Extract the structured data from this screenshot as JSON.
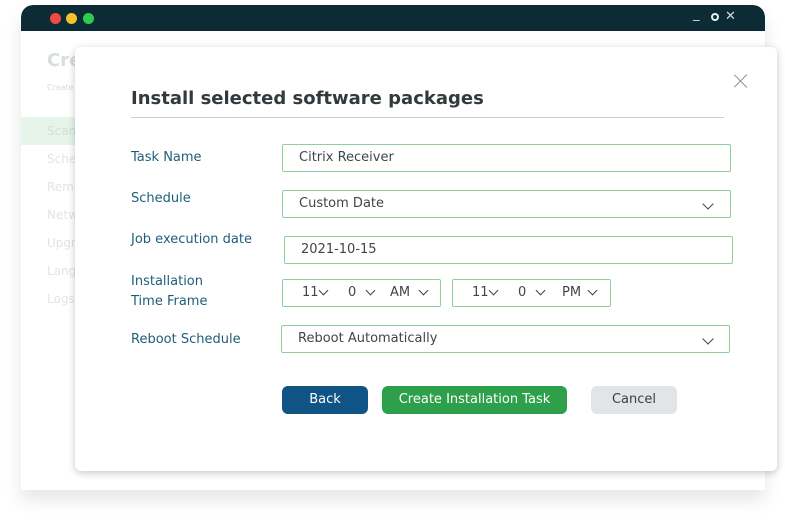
{
  "background": {
    "title": "Cre",
    "subtitle": "Create",
    "nav": [
      {
        "label": "Scan",
        "active": true
      },
      {
        "label": "Sche",
        "active": false
      },
      {
        "label": "Rem",
        "active": false
      },
      {
        "label": "Netw",
        "active": false
      },
      {
        "label": "Upgr",
        "active": false
      },
      {
        "label": "Lang",
        "active": false
      },
      {
        "label": "Logs",
        "active": false
      }
    ],
    "window_controls": {
      "minimize": "_",
      "close": "✕"
    }
  },
  "dialog": {
    "title": "Install selected software packages",
    "fields": {
      "task_name": {
        "label": "Task Name",
        "value": "Citrix Receiver"
      },
      "schedule": {
        "label": "Schedule",
        "value": "Custom Date"
      },
      "job_date": {
        "label": "Job execution date",
        "value": "2021-10-15"
      },
      "time_frame": {
        "label_line1": "Installation",
        "label_line2": "Time Frame",
        "start": {
          "hour": "11",
          "minute": "0",
          "meridiem": "AM"
        },
        "end": {
          "hour": "11",
          "minute": "0",
          "meridiem": "PM"
        }
      },
      "reboot": {
        "label": "Reboot Schedule",
        "value": "Reboot Automatically"
      }
    },
    "buttons": {
      "back": "Back",
      "create": "Create Installation Task",
      "cancel": "Cancel"
    }
  },
  "colors": {
    "titlebar": "#0d2b35",
    "label": "#1f5e7a",
    "field_border": "#8fcf9e",
    "back_button": "#0f5485",
    "create_button": "#2ea04b",
    "cancel_button": "#e2e4e5"
  },
  "icons": [
    "close-icon",
    "chevron-down-icon"
  ]
}
